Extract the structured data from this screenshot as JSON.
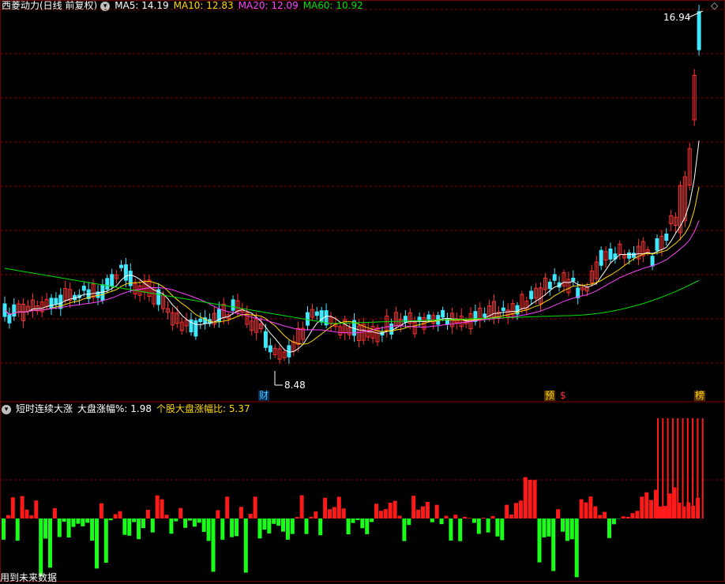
{
  "main": {
    "title": "西菱动力(日线 前复权)",
    "ma": [
      {
        "label": "MA5: 14.19",
        "color": "#ffffff"
      },
      {
        "label": "MA10: 12.83",
        "color": "#ffd700"
      },
      {
        "label": "MA20: 12.09",
        "color": "#ff40ff"
      },
      {
        "label": "MA60: 10.92",
        "color": "#00e000"
      }
    ],
    "high_label": "16.94",
    "low_label": "8.48",
    "events": {
      "cai": "财",
      "yu": "预",
      "dollar": "$",
      "bang": "榜"
    },
    "colors": {
      "up": "#ff3030",
      "down": "#40e8ff",
      "grid": "#8b0000",
      "ma5": "#ffffff",
      "ma10": "#ffd700",
      "ma20": "#ff40ff",
      "ma60": "#00e000"
    }
  },
  "sub": {
    "title": "短时连续大涨",
    "indicators": [
      {
        "label": "大盘涨幅%: 1.98",
        "color": "#ffffff"
      },
      {
        "label": "个股大盘涨幅比: 5.37",
        "color": "#ffd700"
      }
    ],
    "colors": {
      "pos": "#ff1a1a",
      "neg": "#19ff19"
    }
  },
  "footer_note": "用到未来数据",
  "icons": [
    "chevron-down-icon",
    "diamond-icon"
  ]
}
